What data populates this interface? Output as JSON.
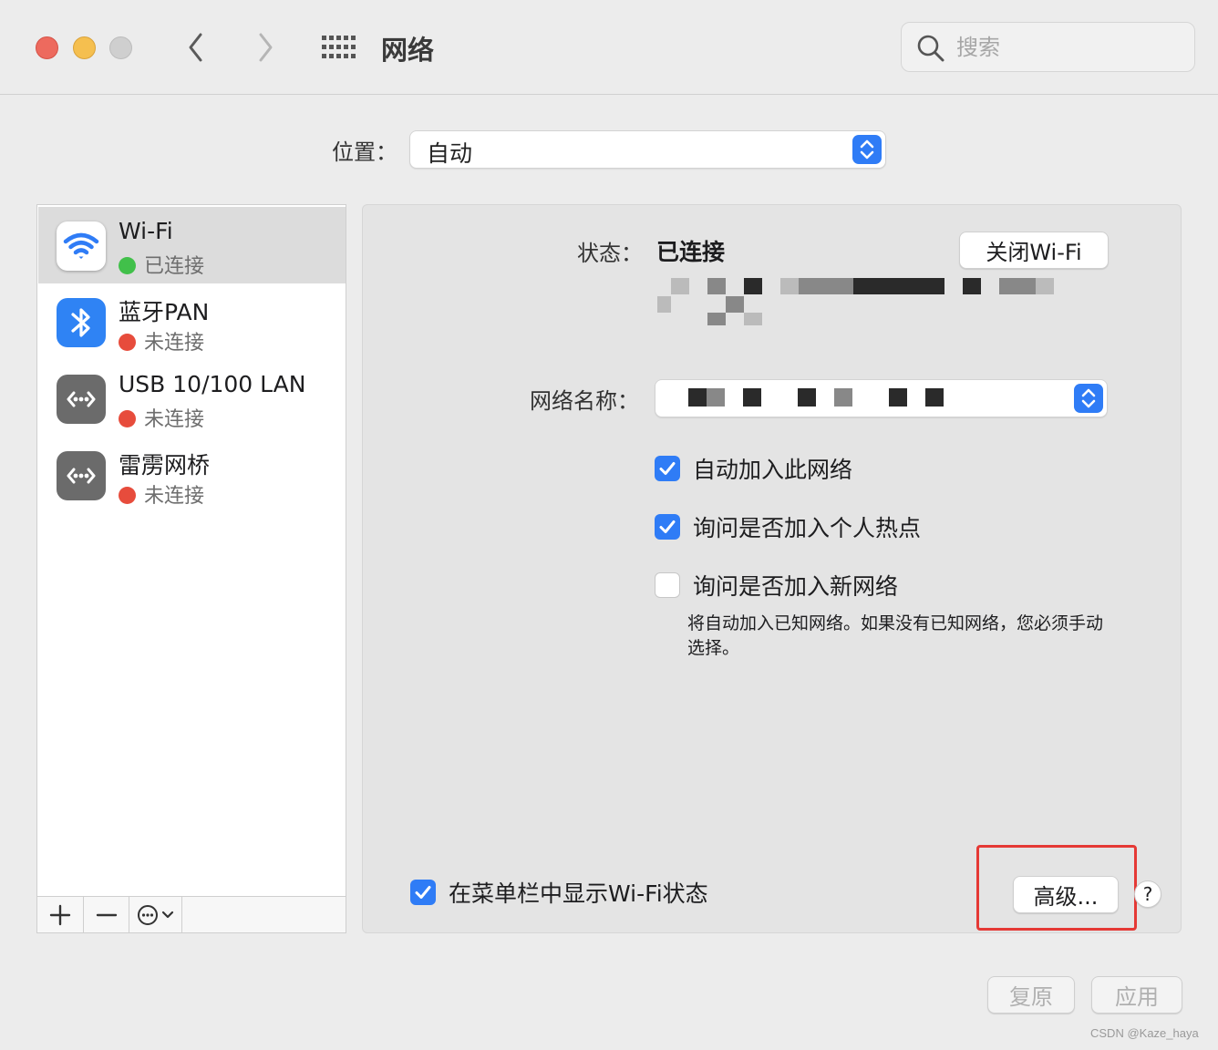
{
  "window": {
    "title": "网络"
  },
  "search": {
    "placeholder": "搜索"
  },
  "location": {
    "label": "位置：",
    "value": "自动"
  },
  "services": [
    {
      "name": "Wi-Fi",
      "status": "已连接",
      "icon": "wifi-icon"
    },
    {
      "name": "蓝牙PAN",
      "status": "未连接",
      "icon": "bluetooth-icon"
    },
    {
      "name": "USB 10/100 LAN",
      "status": "未连接",
      "icon": "ethernet-icon"
    },
    {
      "name": "雷雳网桥",
      "status": "未连接",
      "icon": "ethernet-icon"
    }
  ],
  "detail": {
    "status_label": "状态：",
    "status_value": "已连接",
    "wifi_off_button": "关闭Wi-Fi",
    "ssid_label": "网络名称：",
    "options": [
      {
        "label": "自动加入此网络",
        "checked": true
      },
      {
        "label": "询问是否加入个人热点",
        "checked": true
      },
      {
        "label": "询问是否加入新网络",
        "checked": false
      }
    ],
    "hint": "将自动加入已知网络。如果没有已知网络，您必须手动选择。",
    "menubar_label": "在菜单栏中显示Wi-Fi状态",
    "menubar_checked": true,
    "advanced_button": "高级...",
    "help_button": "?"
  },
  "footer": {
    "revert_button": "复原",
    "apply_button": "应用"
  },
  "watermark": "CSDN @Kaze_haya",
  "colors": {
    "accent": "#2f7cf6",
    "connected": "#41c04a",
    "disconnected": "#e74c3c",
    "highlight": "#e53935"
  }
}
